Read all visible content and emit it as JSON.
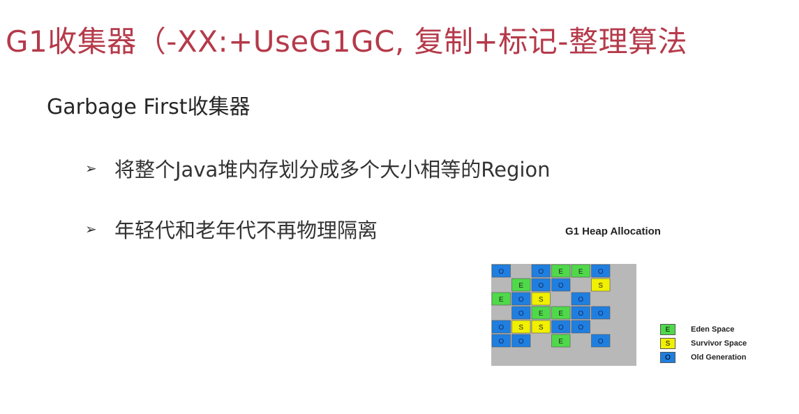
{
  "slide": {
    "title": "G1收集器（-XX:+UseG1GC, 复制+标记-整理算法",
    "subtitle": "Garbage First收集器",
    "bullets": [
      "将整个Java堆内存划分成多个大小相等的Region",
      "年轻代和老年代不再物理隔离"
    ],
    "bullet_icon": "arrow-bullet-icon"
  },
  "figure": {
    "title": "G1 Heap Allocation",
    "grid": [
      [
        "O",
        "",
        "O",
        "E",
        "E",
        "O",
        "",
        ""
      ],
      [
        "",
        "E",
        "O",
        "O",
        "",
        "S",
        "",
        ""
      ],
      [
        "E",
        "O",
        "S",
        "",
        "O",
        "",
        "",
        ""
      ],
      [
        "",
        "O",
        "E",
        "E",
        "O",
        "O",
        "",
        ""
      ],
      [
        "O",
        "S",
        "S",
        "O",
        "O",
        "",
        "",
        ""
      ],
      [
        "O",
        "O",
        "",
        "E",
        "",
        "O",
        "",
        ""
      ]
    ],
    "legend": [
      {
        "letter": "E",
        "label": "Eden Space",
        "color": "#4fd94a"
      },
      {
        "letter": "S",
        "label": "Survivor Space",
        "color": "#f0f000"
      },
      {
        "letter": "O",
        "label": "Old Generation",
        "color": "#1f7fe0"
      }
    ],
    "colors": {
      "E": "#4fd94a",
      "S": "#f0f000",
      "O": "#1f7fe0",
      "empty": "#b8b8b8"
    }
  }
}
